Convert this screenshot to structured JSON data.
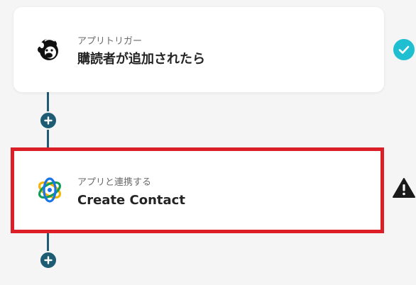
{
  "flow": {
    "steps": [
      {
        "subtitle": "アプリトリガー",
        "title": "購読者が追加されたら",
        "icon": "mailchimp-icon",
        "status": "success"
      },
      {
        "subtitle": "アプリと連携する",
        "title": "Create Contact",
        "icon": "app-logo-icon",
        "status": "warning"
      }
    ]
  },
  "colors": {
    "accent": "#1d5c73",
    "highlight_border": "#dc1f26",
    "success": "#1fbfd1",
    "warning": "#1a1a1a"
  }
}
